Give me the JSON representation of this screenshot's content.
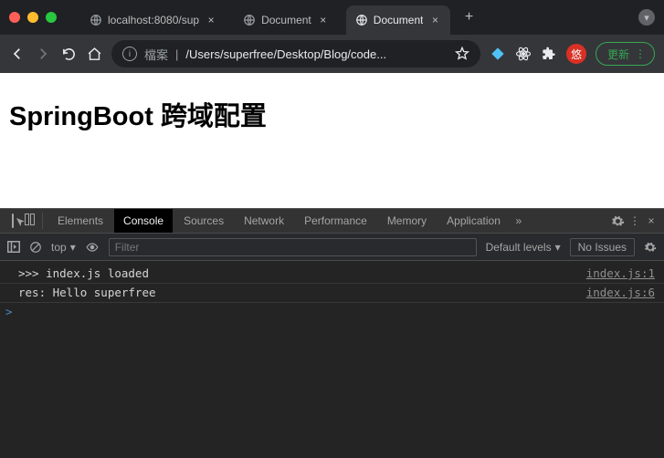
{
  "window": {
    "traffic_colors": {
      "close": "#ff5f57",
      "min": "#febc2e",
      "max": "#28c840"
    }
  },
  "tabs": [
    {
      "title": "localhost:8080/sup",
      "active": false
    },
    {
      "title": "Document",
      "active": false
    },
    {
      "title": "Document",
      "active": true
    }
  ],
  "toolbar": {
    "url_prefix": "檔案",
    "url_path": "/Users/superfree/Desktop/Blog/code...",
    "update_label": "更新",
    "badge_label": "悠"
  },
  "page": {
    "heading": "SpringBoot 跨域配置"
  },
  "devtools": {
    "tabs": {
      "elements": "Elements",
      "console": "Console",
      "sources": "Sources",
      "network": "Network",
      "performance": "Performance",
      "memory": "Memory",
      "application": "Application"
    },
    "sub": {
      "context": "top",
      "filter_placeholder": "Filter",
      "levels": "Default levels",
      "issues": "No Issues"
    },
    "logs": [
      {
        "msg": ">>> index.js loaded",
        "src": "index.js:1"
      },
      {
        "msg": "res: Hello superfree",
        "src": "index.js:6"
      }
    ],
    "prompt": ">"
  }
}
